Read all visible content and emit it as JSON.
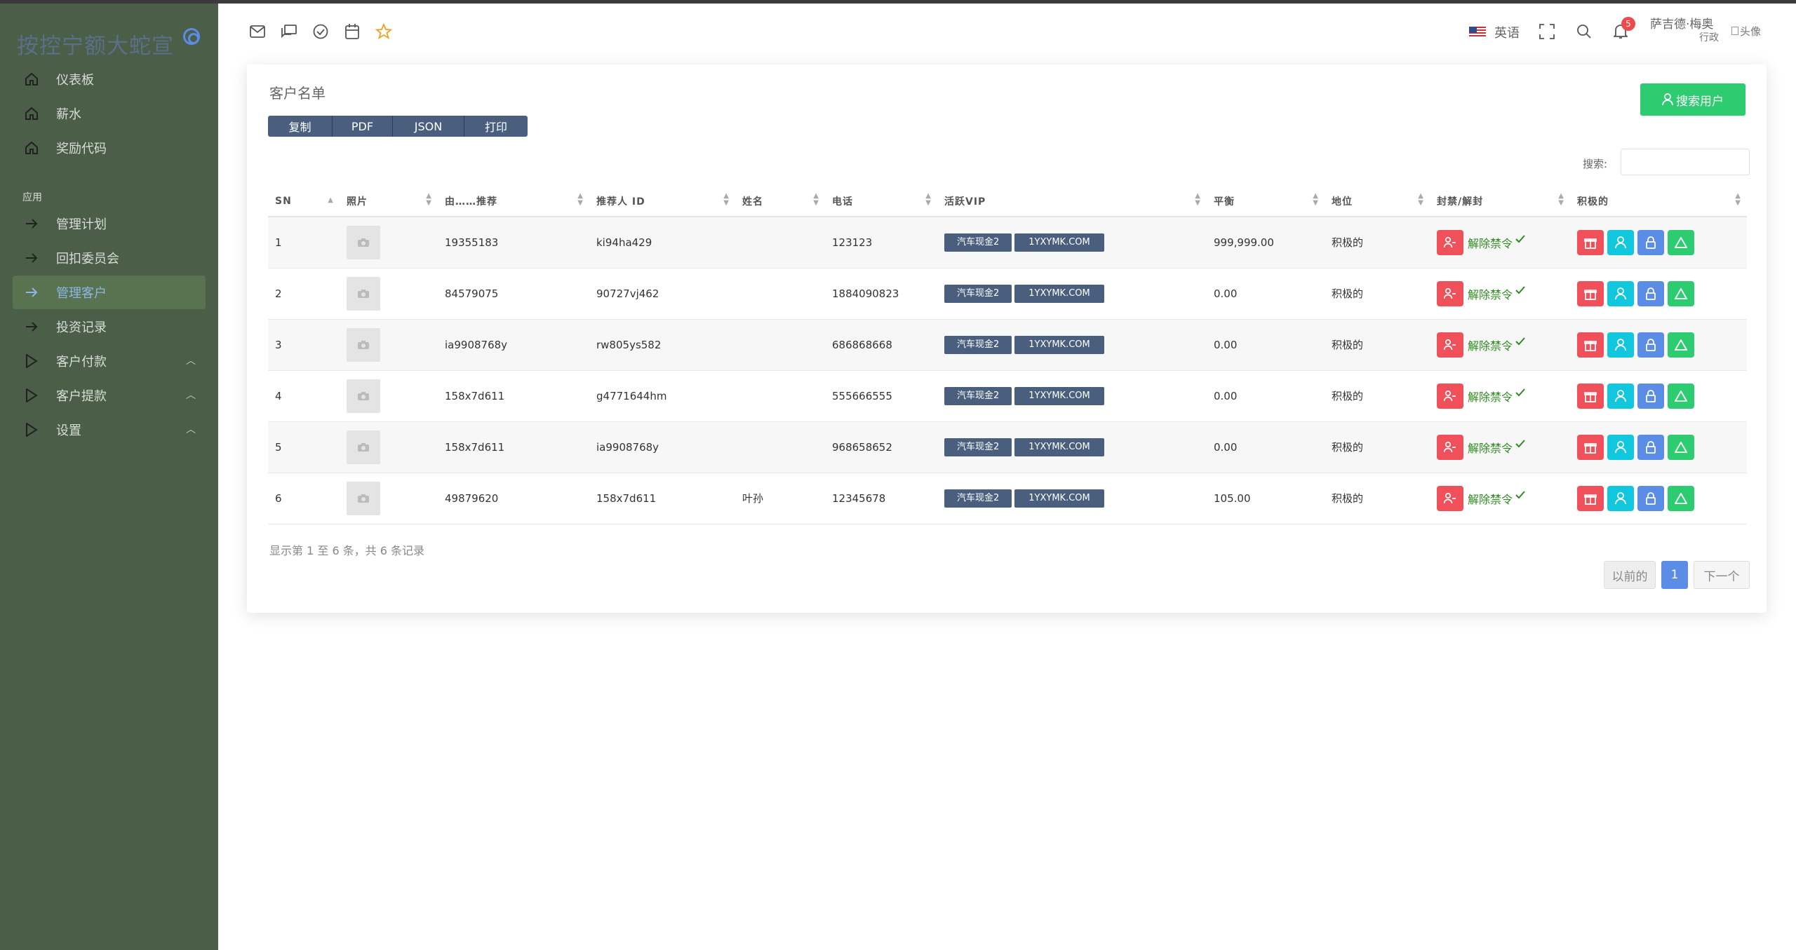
{
  "brand": {
    "title": "按控宁额大蛇宣"
  },
  "sidebar": {
    "items_top": [
      {
        "label": "仪表板",
        "icon": "home-icon"
      },
      {
        "label": "薪水",
        "icon": "home-icon"
      },
      {
        "label": "奖励代码",
        "icon": "home-icon"
      }
    ],
    "section": "应用",
    "items_app": [
      {
        "label": "管理计划",
        "icon": "arrow-right-icon"
      },
      {
        "label": "回扣委员会",
        "icon": "arrow-right-icon"
      },
      {
        "label": "管理客户",
        "icon": "arrow-right-icon",
        "active": true
      },
      {
        "label": "投资记录",
        "icon": "arrow-right-icon"
      },
      {
        "label": "客户付款",
        "icon": "play-icon",
        "expandable": true
      },
      {
        "label": "客户提款",
        "icon": "play-icon",
        "expandable": true
      },
      {
        "label": "设置",
        "icon": "play-icon",
        "expandable": true
      }
    ]
  },
  "header": {
    "icons": [
      "mail-icon",
      "chat-icon",
      "check-circle-icon",
      "calendar-icon",
      "star-icon"
    ],
    "language": "英语",
    "notification_count": "5",
    "user_name": "萨吉德·梅奥",
    "user_role": "行政",
    "avatar_alt": "头像"
  },
  "card": {
    "title": "客户名单",
    "toolbar": [
      "复制",
      "PDF",
      "JSON",
      "打印"
    ],
    "search_user_button": "搜索用户",
    "search_label": "搜索:",
    "search_value": "",
    "columns": [
      "SN",
      "照片",
      "由……推荐",
      "推荐人 ID",
      "姓名",
      "电话",
      "活跃VIP",
      "平衡",
      "地位",
      "封禁/解封",
      "积极的"
    ],
    "rows": [
      {
        "sn": "1",
        "referred_by": "19355183",
        "referrer_id": "ki94ha429",
        "name": "",
        "phone": "123123",
        "vip": "汽车现金2",
        "vip_code": "1YXYMK.COM",
        "balance": "999,999.00",
        "status": "积极的",
        "ban_text": "解除禁令"
      },
      {
        "sn": "2",
        "referred_by": "84579075",
        "referrer_id": "90727vj462",
        "name": "",
        "phone": "1884090823",
        "vip": "汽车现金2",
        "vip_code": "1YXYMK.COM",
        "balance": "0.00",
        "status": "积极的",
        "ban_text": "解除禁令"
      },
      {
        "sn": "3",
        "referred_by": "ia9908768y",
        "referrer_id": "rw805ys582",
        "name": "",
        "phone": "686868668",
        "vip": "汽车现金2",
        "vip_code": "1YXYMK.COM",
        "balance": "0.00",
        "status": "积极的",
        "ban_text": "解除禁令"
      },
      {
        "sn": "4",
        "referred_by": "158x7d611",
        "referrer_id": "g4771644hm",
        "name": "",
        "phone": "555666555",
        "vip": "汽车现金2",
        "vip_code": "1YXYMK.COM",
        "balance": "0.00",
        "status": "积极的",
        "ban_text": "解除禁令"
      },
      {
        "sn": "5",
        "referred_by": "158x7d611",
        "referrer_id": "ia9908768y",
        "name": "",
        "phone": "968658652",
        "vip": "汽车现金2",
        "vip_code": "1YXYMK.COM",
        "balance": "0.00",
        "status": "积极的",
        "ban_text": "解除禁令"
      },
      {
        "sn": "6",
        "referred_by": "49879620",
        "referrer_id": "158x7d611",
        "name": "叶孙",
        "phone": "12345678",
        "vip": "汽车现金2",
        "vip_code": "1YXYMK.COM",
        "balance": "105.00",
        "status": "积极的",
        "ban_text": "解除禁令"
      }
    ],
    "footer_info": "显示第 1 至 6 条，共 6 条记录",
    "pager": {
      "prev": "以前的",
      "current": "1",
      "next": "下一个"
    }
  },
  "colors": {
    "sidebar_bg": "#4a5e48",
    "primary_dark": "#4a5f7e",
    "success": "#2ecc71",
    "danger": "#f0505a",
    "info": "#10c7dd",
    "primary": "#5b8de6"
  }
}
